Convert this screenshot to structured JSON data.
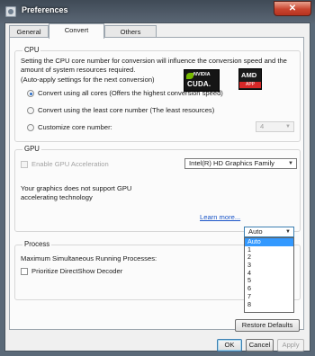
{
  "window": {
    "title": "Preferences",
    "close_glyph": "✕"
  },
  "tabs": [
    {
      "label": "General",
      "active": false
    },
    {
      "label": "Convert",
      "active": true
    },
    {
      "label": "Others",
      "active": false
    }
  ],
  "cpu": {
    "group_title": "CPU",
    "description": "Setting the CPU core number for conversion will influence the conversion speed and the amount of system resources required.",
    "auto_apply": "(Auto-apply settings for the next conversion)",
    "options": [
      {
        "label": "Convert using all cores (Offers the highest conversion speed)",
        "checked": true
      },
      {
        "label": "Convert using the least core number (The least resources)",
        "checked": false
      },
      {
        "label": "Customize core number:",
        "checked": false
      }
    ],
    "core_combo_value": "4"
  },
  "gpu": {
    "group_title": "GPU",
    "enable_label": "Enable GPU Acceleration",
    "enable_checked": false,
    "adapter_value": "Intel(R) HD Graphics Family",
    "note": "Your graphics does not support GPU accelerating technology",
    "nvidia_brand": "NVIDIA",
    "nvidia_product": "CUDA.",
    "amd_brand": "AMD",
    "amd_product": "APP",
    "learn_more": "Learn more..."
  },
  "process": {
    "group_title": "Process",
    "max_label": "Maximum Simultaneous Running Processes:",
    "max_value": "Auto",
    "dropdown_options": [
      "Auto",
      "1",
      "2",
      "3",
      "4",
      "5",
      "6",
      "7",
      "8"
    ],
    "selected_index": 0,
    "prioritize_label": "Prioritize DirectShow Decoder",
    "prioritize_checked": false,
    "restore_label": "Restore Defaults"
  },
  "footer": {
    "ok": "OK",
    "cancel": "Cancel",
    "apply": "Apply"
  },
  "icons": {
    "dropdown": "▼"
  },
  "colors": {
    "selection": "#3399ff",
    "link": "#1a55c8",
    "nvidia_green": "#76b900",
    "amd_red": "#d62828"
  }
}
